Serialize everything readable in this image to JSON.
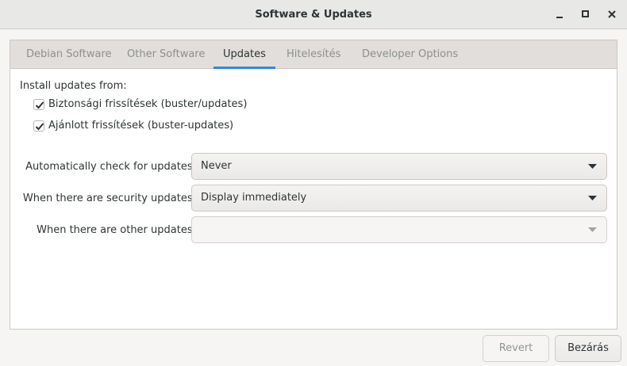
{
  "window": {
    "title": "Software & Updates"
  },
  "tabs": [
    {
      "label": "Debian Software"
    },
    {
      "label": "Other Software"
    },
    {
      "label": "Updates"
    },
    {
      "label": "Hitelesítés"
    },
    {
      "label": "Developer Options"
    }
  ],
  "active_tab": "Updates",
  "updates": {
    "install_from_label": "Install updates from:",
    "sources": [
      {
        "label": "Biztonsági frissítések (buster/updates)",
        "checked": true
      },
      {
        "label": "Ajánlott frissítések (buster-updates)",
        "checked": true
      }
    ],
    "settings": [
      {
        "label": "Automatically check for updates:",
        "value": "Never",
        "enabled": true
      },
      {
        "label": "When there are security updates:",
        "value": "Display immediately",
        "enabled": true
      },
      {
        "label": "When there are other updates:",
        "value": "",
        "enabled": false
      }
    ]
  },
  "buttons": {
    "revert": "Revert",
    "close": "Bezárás"
  },
  "colors": {
    "accent": "#3584e4"
  }
}
